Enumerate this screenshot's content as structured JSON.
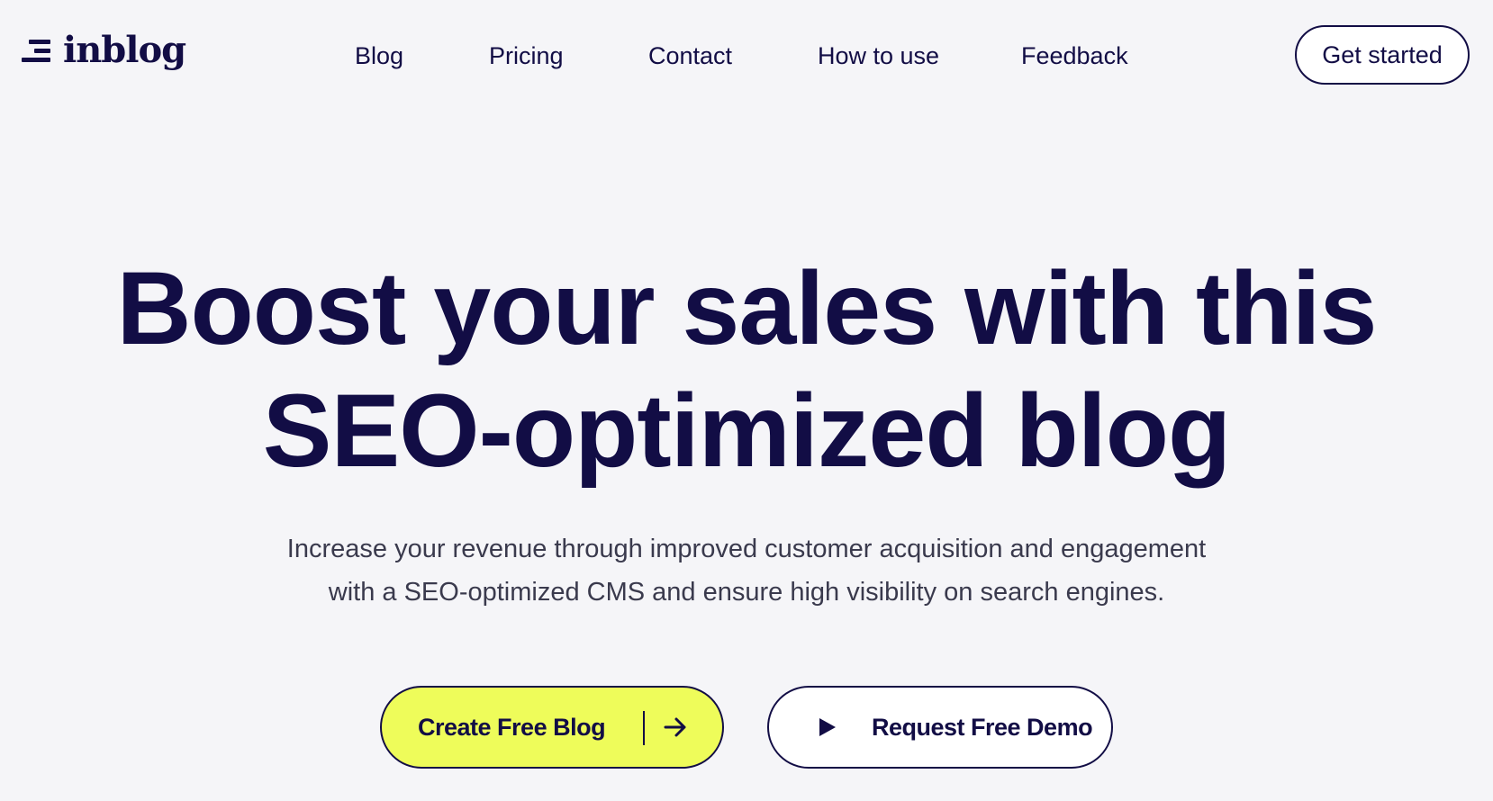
{
  "header": {
    "logo_text": "inblog",
    "nav": [
      {
        "label": "Blog"
      },
      {
        "label": "Pricing"
      },
      {
        "label": "Contact"
      },
      {
        "label": "How to use"
      },
      {
        "label": "Feedback"
      }
    ],
    "cta_label": "Get started"
  },
  "hero": {
    "title_line1": "Boost your sales with this",
    "title_line2": "SEO-optimized blog",
    "subtitle_line1": "Increase your revenue through improved customer acquisition and engagement",
    "subtitle_line2": "with a SEO-optimized CMS and ensure high visibility on search engines."
  },
  "actions": {
    "create_label": "Create Free Blog",
    "create_icon": "arrow-right-icon",
    "demo_label": "Request Free Demo",
    "demo_icon": "play-icon"
  },
  "colors": {
    "background": "#f5f5f8",
    "brand_navy": "#120d45",
    "accent_lime": "#eefc5a"
  }
}
